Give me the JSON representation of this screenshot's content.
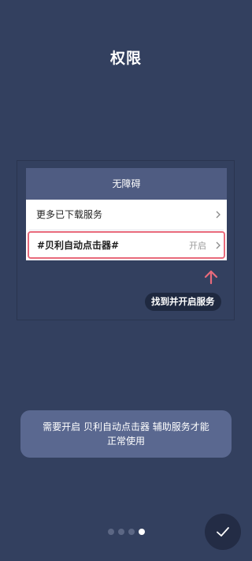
{
  "page": {
    "title": "权限"
  },
  "accessibility": {
    "header": "无障碍",
    "rows": [
      {
        "label": "更多已下载服务"
      },
      {
        "label": "#贝利自动点击器#",
        "status": "开启"
      }
    ],
    "hint": "找到并开启服务"
  },
  "notice": {
    "line1": "需要开启 贝利自动点击器 辅助服务才能",
    "line2": "正常使用"
  },
  "pager": {
    "total": 4,
    "current": 4
  },
  "icons": {
    "row_chevron": "chevron-right-icon",
    "hint_arrow": "arrow-up-icon",
    "confirm": "check-icon"
  },
  "colors": {
    "background": "#33405f",
    "card_header": "#4f5c82",
    "highlight": "#e86a7b",
    "notice": "#5a6890",
    "confirm_button": "#232c45"
  }
}
